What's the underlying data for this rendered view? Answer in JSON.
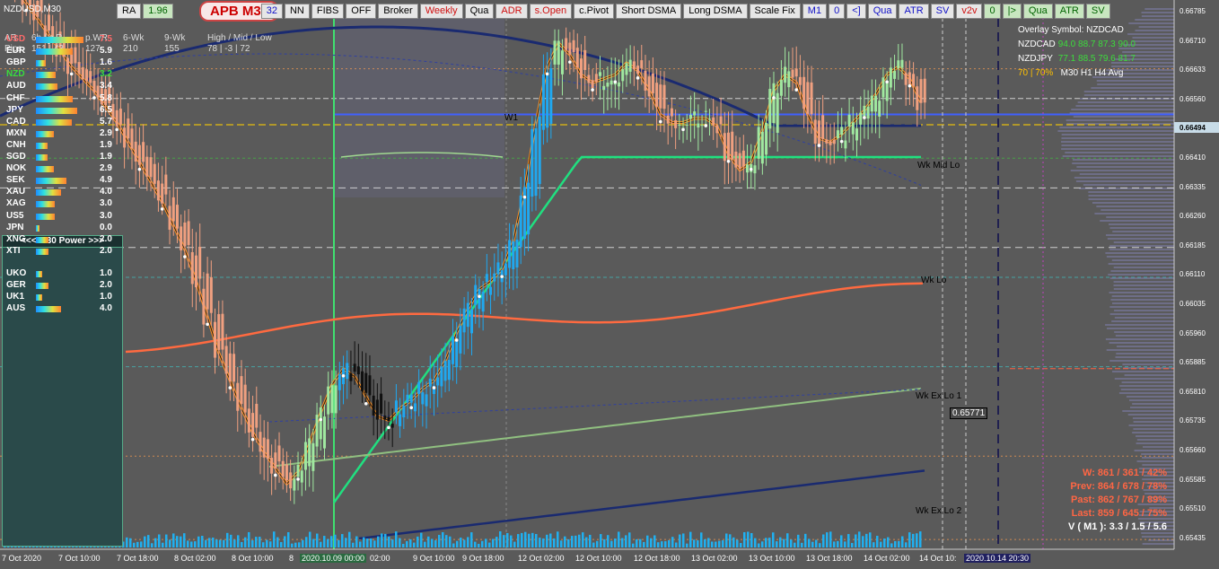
{
  "symbol": "NZDUSD,M30",
  "badge": "APB M30",
  "toolbar": [
    {
      "label": "RA",
      "cls": ""
    },
    {
      "label": "1.96",
      "cls": "green"
    },
    {
      "label": "32",
      "cls": "blue"
    },
    {
      "label": "NN",
      "cls": ""
    },
    {
      "label": "FIBS",
      "cls": ""
    },
    {
      "label": "OFF",
      "cls": ""
    },
    {
      "label": "Broker",
      "cls": ""
    },
    {
      "label": "Weekly",
      "cls": "red"
    },
    {
      "label": "Qua",
      "cls": ""
    },
    {
      "label": "ADR",
      "cls": "red"
    },
    {
      "label": "s.Open",
      "cls": "red"
    },
    {
      "label": "c.Pivot",
      "cls": ""
    },
    {
      "label": "Short DSMA",
      "cls": ""
    },
    {
      "label": "Long DSMA",
      "cls": ""
    },
    {
      "label": "Scale Fix",
      "cls": ""
    },
    {
      "label": "M1",
      "cls": "blue"
    },
    {
      "label": "0",
      "cls": "blue"
    },
    {
      "label": "<]",
      "cls": "blue"
    },
    {
      "label": "Qua",
      "cls": "blue"
    },
    {
      "label": "ATR",
      "cls": "blue"
    },
    {
      "label": "SV",
      "cls": "blue"
    },
    {
      "label": "v2v",
      "cls": "red"
    },
    {
      "label": "0",
      "cls": "green"
    },
    {
      "label": "|>",
      "cls": "green"
    },
    {
      "label": "Qua",
      "cls": "green"
    },
    {
      "label": "ATR",
      "cls": "green"
    },
    {
      "label": "SV",
      "cls": "green"
    }
  ],
  "stats": {
    "row1": [
      "AR",
      "6h / c.R",
      "p.WR",
      "6-Wk",
      "9-Wk",
      "High / Mid / Low"
    ],
    "row2": [
      "Pips",
      "151 | 43",
      "127",
      "210",
      "155",
      "78 | -3 | 72"
    ]
  },
  "power": {
    "header": "<<<  M30  Power  >>>",
    "rows": [
      {
        "cur": "USD",
        "val": "7.5",
        "color": "#ff6a6a",
        "level": 0.75
      },
      {
        "cur": "EUR",
        "val": "5.9",
        "color": "#ffffff",
        "level": 0.59
      },
      {
        "cur": "GBP",
        "val": "1.6",
        "color": "#ffffff",
        "level": 0.16
      },
      {
        "cur": "NZD",
        "val": "3.2",
        "color": "#3cdc3c",
        "level": 0.32
      },
      {
        "cur": "AUD",
        "val": "3.4",
        "color": "#ffffff",
        "level": 0.34
      },
      {
        "cur": "CHF",
        "val": "5.8",
        "color": "#ffffff",
        "level": 0.58
      },
      {
        "cur": "JPY",
        "val": "6.5",
        "color": "#ffffff",
        "level": 0.65
      },
      {
        "cur": "CAD",
        "val": "5.7",
        "color": "#ffffff",
        "level": 0.57
      },
      {
        "cur": "MXN",
        "val": "2.9",
        "color": "#ffffff",
        "level": 0.29
      },
      {
        "cur": "CNH",
        "val": "1.9",
        "color": "#ffffff",
        "level": 0.19
      },
      {
        "cur": "SGD",
        "val": "1.9",
        "color": "#ffffff",
        "level": 0.19
      },
      {
        "cur": "NOK",
        "val": "2.9",
        "color": "#ffffff",
        "level": 0.29
      },
      {
        "cur": "SEK",
        "val": "4.9",
        "color": "#ffffff",
        "level": 0.49
      },
      {
        "cur": "XAU",
        "val": "4.0",
        "color": "#ffffff",
        "level": 0.4
      },
      {
        "cur": "XAG",
        "val": "3.0",
        "color": "#ffffff",
        "level": 0.3
      },
      {
        "cur": "US5",
        "val": "3.0",
        "color": "#ffffff",
        "level": 0.3
      },
      {
        "cur": "JPN",
        "val": "0.0",
        "color": "#ffffff",
        "level": 0.0
      },
      {
        "cur": "XNG",
        "val": "2.0",
        "color": "#ffffff",
        "level": 0.2
      },
      {
        "cur": "XTI",
        "val": "2.0",
        "color": "#ffffff",
        "level": 0.2
      },
      {
        "cur": "UKO",
        "val": "1.0",
        "color": "#ffffff",
        "level": 0.1
      },
      {
        "cur": "GER",
        "val": "2.0",
        "color": "#ffffff",
        "level": 0.2
      },
      {
        "cur": "UK1",
        "val": "1.0",
        "color": "#ffffff",
        "level": 0.1
      },
      {
        "cur": "AUS",
        "val": "4.0",
        "color": "#ffffff",
        "level": 0.4
      }
    ]
  },
  "overlay": {
    "title": "Overlay Symbol: NZDCAD",
    "rows": [
      {
        "sym": "NZDCAD",
        "vals": "94.0   88.7   87.3   90.0"
      },
      {
        "sym": "NZDJPY",
        "vals": "77.1   88.5   79.6   81.7"
      }
    ],
    "footer_y": "70 | 70%",
    "footer": "M30      H1      H4     Avg"
  },
  "weekly": [
    {
      "text": "W: 861 / 361 / 42%",
      "cls": ""
    },
    {
      "text": "Prev: 864 / 678 / 78%",
      "cls": ""
    },
    {
      "text": "Past: 862 / 767 / 89%",
      "cls": ""
    },
    {
      "text": "Last: 859 / 645 / 75%",
      "cls": ""
    },
    {
      "text": "V ( M1 ): 3.3 / 1.5 / 5.6",
      "cls": "w"
    }
  ],
  "levels": [
    {
      "text": "W1",
      "color": "#ffffff"
    },
    {
      "text": "Wk Mid Lo",
      "color": "#ff8060"
    },
    {
      "text": "Wk Lo",
      "color": "#ff8060"
    },
    {
      "text": "Wk Ex Lo 1",
      "color": "#ff8060"
    },
    {
      "text": "Wk Ex Lo 2",
      "color": "#ff8060"
    }
  ],
  "box_price": "0.65771",
  "current_price": "0.66494",
  "price_axis": [
    "0.66785",
    "0.66710",
    "0.66633",
    "0.66560",
    "0.66494",
    "0.66410",
    "0.66335",
    "0.66260",
    "0.66185",
    "0.66110",
    "0.66035",
    "0.65960",
    "0.65885",
    "0.65810",
    "0.65735",
    "0.65660",
    "0.65585",
    "0.65510",
    "0.65435"
  ],
  "time_axis": [
    "7 Oct 2020",
    "7 Oct 10:00",
    "7 Oct 18:00",
    "8 Oct 02:00",
    "8 Oct 10:00",
    "8",
    "2020.10.09 00:00",
    "02:00",
    "9 Oct 10:00",
    "9 Oct 18:00",
    "12 Oct 02:00",
    "12 Oct 10:00",
    "12 Oct 18:00",
    "13 Oct 02:00",
    "13 Oct 10:00",
    "13 Oct 18:00",
    "14 Oct 02:00",
    "14 Oct 10:",
    "2020.10.14 20:30"
  ],
  "chart_data": {
    "type": "candlestick",
    "ylim": [
      0.6543,
      0.6679
    ],
    "close": [
      0.6688,
      0.6684,
      0.668,
      0.6676,
      0.6672,
      0.6668,
      0.6664,
      0.6661,
      0.6658,
      0.6654,
      0.665,
      0.6645,
      0.664,
      0.6635,
      0.663,
      0.6624,
      0.6618,
      0.661,
      0.6601,
      0.6592,
      0.6585,
      0.6578,
      0.6572,
      0.6567,
      0.6563,
      0.6559,
      0.6562,
      0.6569,
      0.6577,
      0.6584,
      0.6588,
      0.6586,
      0.6581,
      0.6576,
      0.6575,
      0.6578,
      0.658,
      0.6583,
      0.6585,
      0.659,
      0.6597,
      0.6603,
      0.6608,
      0.661,
      0.6613,
      0.662,
      0.6633,
      0.665,
      0.6664,
      0.667,
      0.6667,
      0.6662,
      0.666,
      0.6661,
      0.6662,
      0.6665,
      0.6663,
      0.6658,
      0.6652,
      0.665,
      0.665,
      0.6651,
      0.6651,
      0.6649,
      0.6642,
      0.6638,
      0.664,
      0.6648,
      0.6658,
      0.6662,
      0.666,
      0.6652,
      0.6646,
      0.6645,
      0.6647,
      0.665,
      0.6653,
      0.6657,
      0.6662,
      0.6664,
      0.6661,
      0.6655
    ]
  }
}
